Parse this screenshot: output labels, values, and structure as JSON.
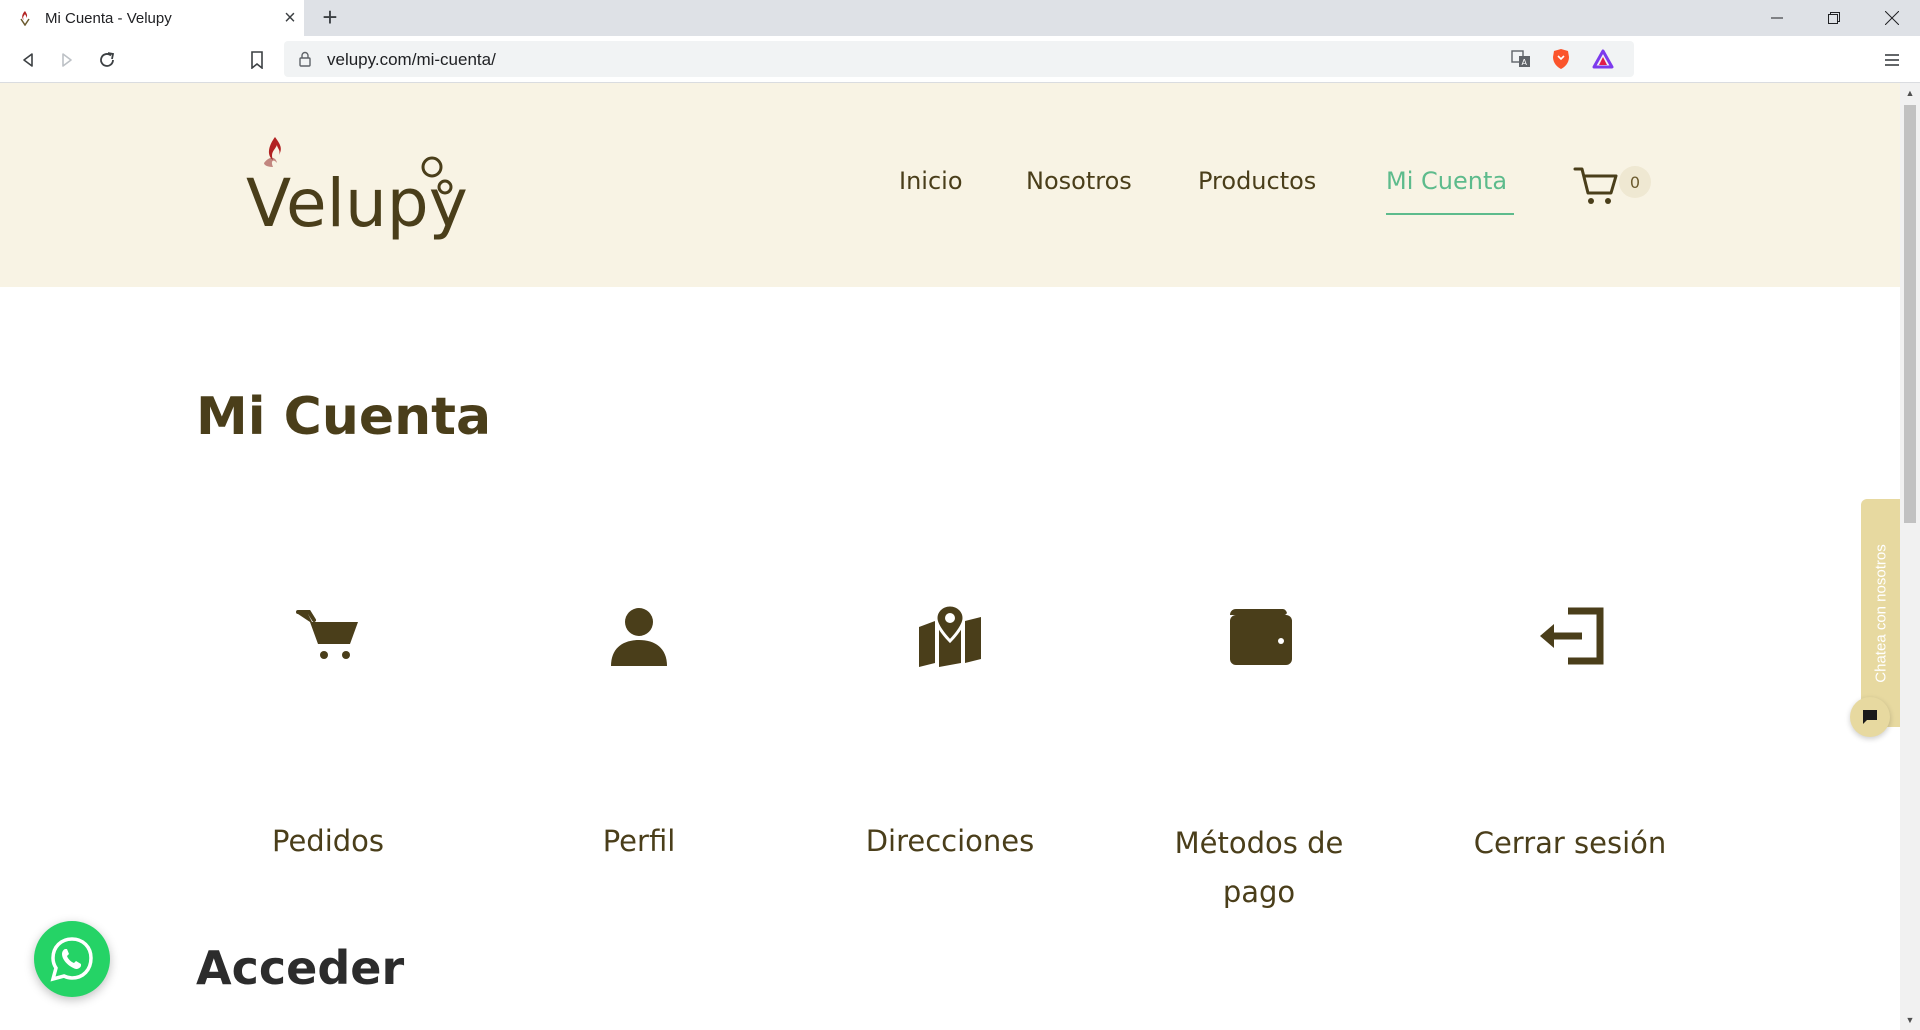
{
  "browser": {
    "tab_title": "Mi Cuenta - Velupy",
    "url": "velupy.com/mi-cuenta/"
  },
  "site": {
    "logo_text": "Velupy",
    "nav": [
      {
        "label": "Inicio"
      },
      {
        "label": "Nosotros"
      },
      {
        "label": "Productos"
      },
      {
        "label": "Mi Cuenta",
        "active": true
      }
    ],
    "cart_count": "0"
  },
  "page": {
    "title": "Mi Cuenta",
    "account_items": [
      {
        "label": "Pedidos",
        "icon": "cart-icon"
      },
      {
        "label": "Perfil",
        "icon": "user-icon"
      },
      {
        "label": "Direcciones",
        "icon": "map-pin-icon"
      },
      {
        "label_line1": "Métodos de",
        "label_line2": "pago",
        "icon": "wallet-icon"
      },
      {
        "label": "Cerrar sesión",
        "icon": "logout-icon"
      }
    ],
    "section_title": "Acceder"
  },
  "widgets": {
    "chat_label": "Chatea con nosotros"
  },
  "colors": {
    "brand_brown": "#4a3e1a",
    "header_bg": "#f8f3e4",
    "accent_green": "#5dbb8c",
    "whatsapp_green": "#25d366"
  }
}
